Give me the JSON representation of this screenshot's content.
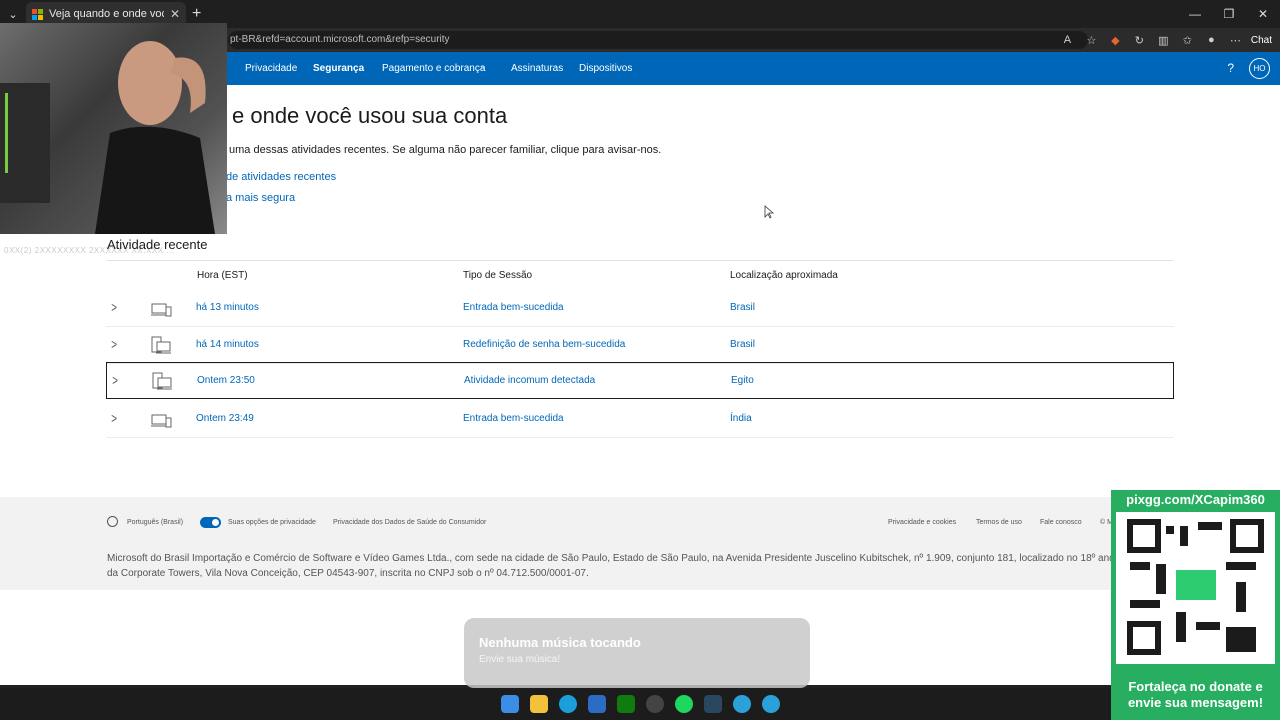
{
  "browser": {
    "tab_title": "Veja quando e onde você usou su",
    "url": "pt-BR&refd=account.microsoft.com&refp=security",
    "chat_label": "Chat"
  },
  "nav": {
    "items": [
      "Privacidade",
      "Segurança",
      "Pagamento e cobrança",
      "Assinaturas",
      "Dispositivos"
    ],
    "avatar": "HO",
    "help": "?"
  },
  "page": {
    "title": "e onde você usou sua conta",
    "subtitle": "uma dessas atividades recentes. Se alguma não parecer familiar, clique para avisar-nos.",
    "link1": "de atividades recentes",
    "link2": "a mais segura",
    "section": "Atividade recente",
    "ghost_text": "0XX(2)    2XXXXXXXX    2XXXXXX    XX:XXX    ..."
  },
  "table": {
    "headers": [
      "Hora (EST)",
      "Tipo de Sessão",
      "Localização aproximada"
    ],
    "rows": [
      {
        "time": "há 13 minutos",
        "type": "Entrada bem-sucedida",
        "location": "Brasil",
        "device": "laptop-phone"
      },
      {
        "time": "há 14 minutos",
        "type": "Redefinição de senha bem-sucedida",
        "location": "Brasil",
        "device": "desktop"
      },
      {
        "time": "Ontem 23:50",
        "type": "Atividade incomum detectada",
        "location": "Egito",
        "device": "desktop"
      },
      {
        "time": "Ontem 23:49",
        "type": "Entrada bem-sucedida",
        "location": "Índia",
        "device": "laptop-phone"
      }
    ]
  },
  "footer": {
    "language": "Português (Brasil)",
    "privacy_choices": "Suas opções de privacidade",
    "health_privacy": "Privacidade dos Dados de Saúde do Consumidor",
    "links": [
      "Privacidade e cookies",
      "Termos de uso",
      "Fale conosco",
      "© M"
    ],
    "legal": "Microsoft do Brasil Importação e Comércio de Software e Vídeo Games Ltda., com sede na cidade de São Paulo, Estado de São Paulo, na Avenida Presidente Juscelino Kubitschek, nº 1.909, conjunto 181, localizado no 18º andar da Corporate Towers, Vila Nova Conceição, CEP 04543-907, inscrita no CNPJ sob o nº 04.712.500/0001-07."
  },
  "toast": {
    "title": "Nenhuma música tocando",
    "subtitle": "Envie sua música!"
  },
  "promo": {
    "top": "pixgg.com/XCapim360",
    "bottom": "Fortaleça no donate e envie sua mensagem!"
  },
  "colors": {
    "nav_blue": "#0067b8",
    "link": "#0067b8",
    "promo_green": "#27ae60"
  }
}
